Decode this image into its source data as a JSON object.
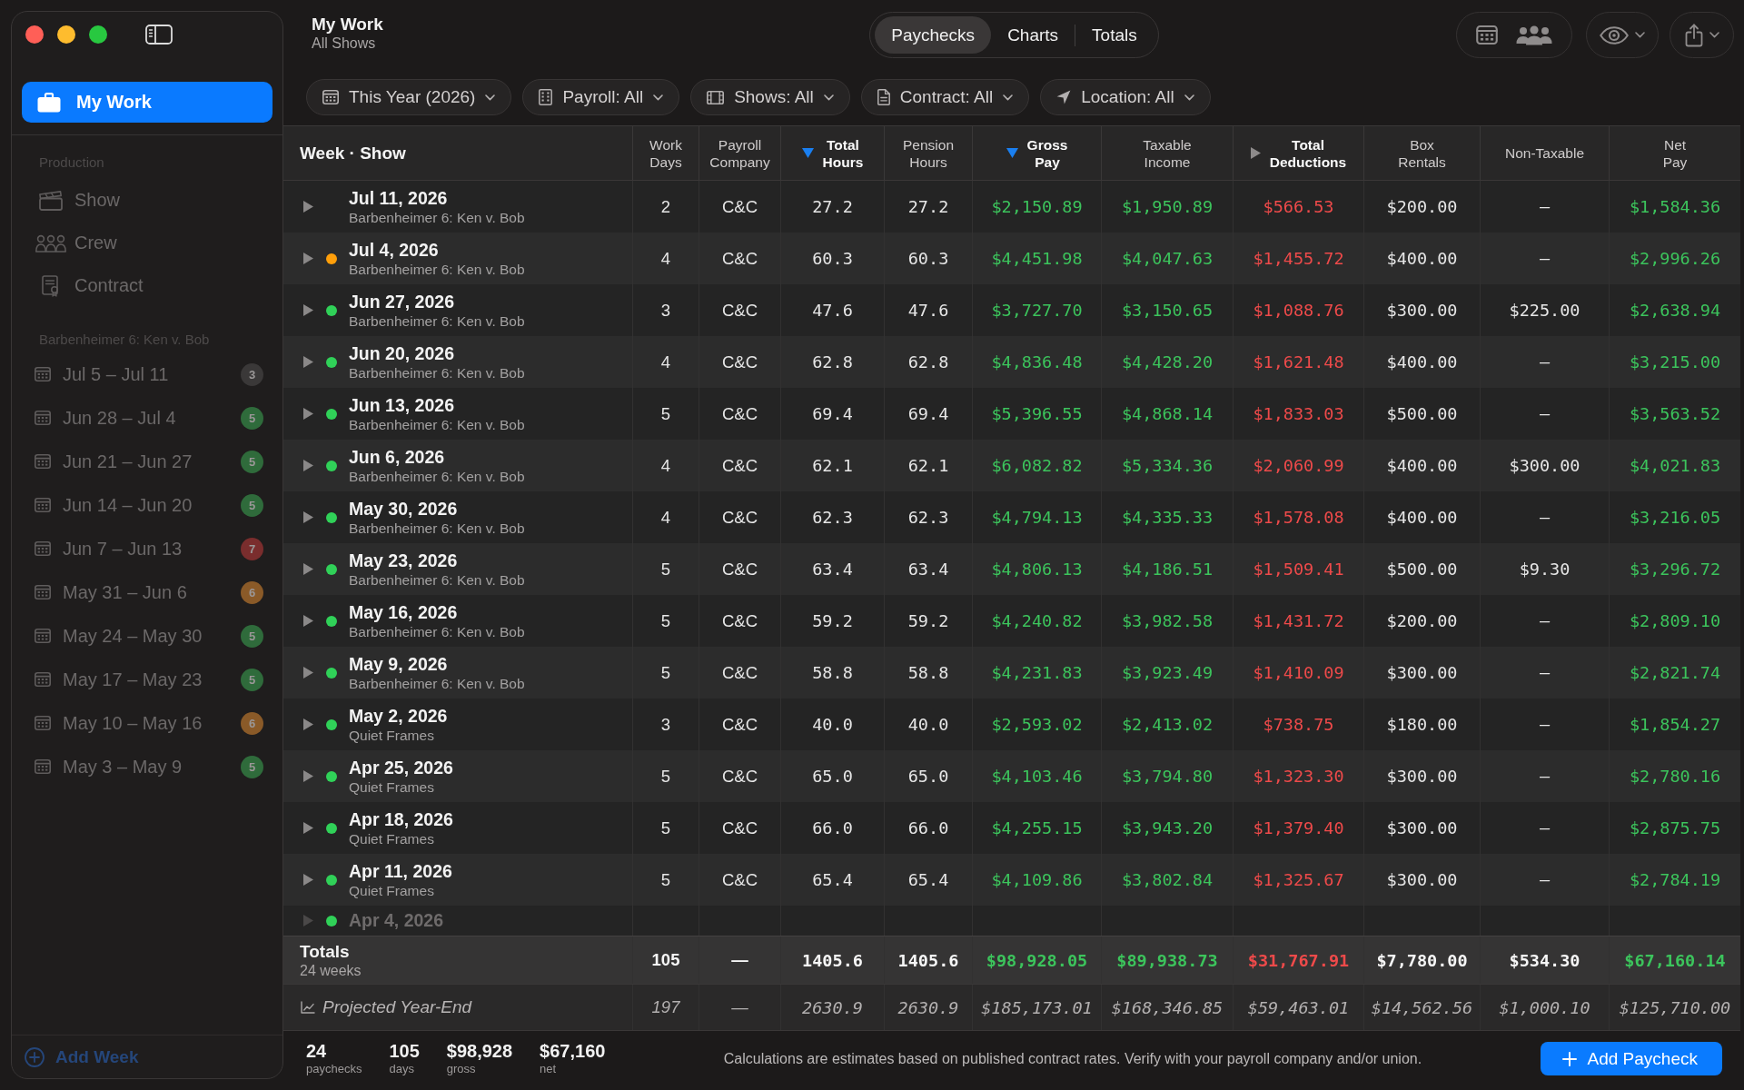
{
  "sidebar": {
    "nav": [
      {
        "label": "My Work",
        "selected": true
      }
    ],
    "sections": [
      {
        "title": "Production",
        "items": [
          {
            "kind": "show",
            "label": "Show",
            "selected": false
          },
          {
            "kind": "crew",
            "label": "Crew",
            "selected": false
          },
          {
            "kind": "contract",
            "label": "Contract",
            "selected": false
          }
        ]
      },
      {
        "title": "Barbenheimer 6: Ken v. Bob",
        "items": [
          {
            "kind": "week",
            "label": "Jul 5 – Jul 11",
            "count": "3",
            "color": "#3a3838",
            "selected": false
          },
          {
            "kind": "week",
            "label": "Jun 28 – Jul 4",
            "count": "5",
            "color": "#2f6b3b",
            "selected": false
          },
          {
            "kind": "week",
            "label": "Jun 21 – Jun 27",
            "count": "5",
            "color": "#2f6b3b",
            "selected": false
          },
          {
            "kind": "week",
            "label": "Jun 14 – Jun 20",
            "count": "5",
            "color": "#2f6b3b",
            "selected": false
          },
          {
            "kind": "week",
            "label": "Jun 7 – Jun 13",
            "count": "7",
            "color": "#7a2d2d",
            "selected": false
          },
          {
            "kind": "week",
            "label": "May 31 – Jun 6",
            "count": "6",
            "color": "#8a5a28",
            "selected": false
          },
          {
            "kind": "week",
            "label": "May 24 – May 30",
            "count": "5",
            "color": "#2f6b3b",
            "selected": false
          },
          {
            "kind": "week",
            "label": "May 17 – May 23",
            "count": "5",
            "color": "#2f6b3b",
            "selected": false
          },
          {
            "kind": "week",
            "label": "May 10 – May 16",
            "count": "6",
            "color": "#8a5a28",
            "selected": false
          },
          {
            "kind": "week",
            "label": "May 3 – May 9",
            "count": "5",
            "color": "#2f6b3b",
            "selected": false
          }
        ]
      }
    ],
    "add_button": "Add Week"
  },
  "header": {
    "title": "My Work",
    "subtitle": "All Shows"
  },
  "view_tabs": [
    {
      "label": "Paychecks",
      "selected": true
    },
    {
      "label": "Charts",
      "selected": false
    },
    {
      "label": "Totals",
      "selected": false
    }
  ],
  "filters": [
    {
      "kind": "period",
      "label": "This Year (2026)"
    },
    {
      "kind": "payroll",
      "label": "Payroll: All"
    },
    {
      "kind": "shows",
      "label": "Shows: All"
    },
    {
      "kind": "contract",
      "label": "Contract: All"
    },
    {
      "kind": "location",
      "label": "Location: All"
    }
  ],
  "table": {
    "columns": [
      {
        "label": "Week · Show",
        "kind": "week",
        "sorted": false
      },
      {
        "label": "Work\nDays",
        "kind": "count",
        "sorted": false
      },
      {
        "label": "Payroll\nCompany",
        "kind": "text",
        "sorted": false
      },
      {
        "label": "Total\nHours",
        "kind": "number",
        "sorted": true
      },
      {
        "label": "Pension\nHours",
        "kind": "number",
        "sorted": false
      },
      {
        "label": "Gross\nPay",
        "kind": "gain",
        "sorted": true
      },
      {
        "label": "Taxable\nIncome",
        "kind": "gain",
        "sorted": false
      },
      {
        "label": "Total\nDeductions",
        "kind": "loss",
        "sorted": false,
        "expanded": false
      },
      {
        "label": "Box\nRentals",
        "kind": "amount",
        "sorted": false
      },
      {
        "label": "Non-Taxable",
        "kind": "amount",
        "sorted": false
      },
      {
        "label": "Net\nPay",
        "kind": "gain",
        "sorted": false
      }
    ],
    "rows": [
      {
        "date": "Jul 11, 2026",
        "show": "Barbenheimer 6: Ken v. Bob",
        "expanded": false,
        "cells": [
          "2",
          "C&C",
          "27.2",
          "27.2",
          "$2,150.89",
          "$1,950.89",
          "$566.53",
          "$200.00",
          "—",
          "$1,584.36"
        ]
      },
      {
        "date": "Jul 4, 2026",
        "show": "Barbenheimer 6: Ken v. Bob",
        "expanded": false,
        "color": "#ff9f0a",
        "cells": [
          "4",
          "C&C",
          "60.3",
          "60.3",
          "$4,451.98",
          "$4,047.63",
          "$1,455.72",
          "$400.00",
          "—",
          "$2,996.26"
        ]
      },
      {
        "date": "Jun 27, 2026",
        "show": "Barbenheimer 6: Ken v. Bob",
        "expanded": false,
        "color": "#30d158",
        "cells": [
          "3",
          "C&C",
          "47.6",
          "47.6",
          "$3,727.70",
          "$3,150.65",
          "$1,088.76",
          "$300.00",
          "$225.00",
          "$2,638.94"
        ]
      },
      {
        "date": "Jun 20, 2026",
        "show": "Barbenheimer 6: Ken v. Bob",
        "expanded": false,
        "color": "#30d158",
        "cells": [
          "4",
          "C&C",
          "62.8",
          "62.8",
          "$4,836.48",
          "$4,428.20",
          "$1,621.48",
          "$400.00",
          "—",
          "$3,215.00"
        ]
      },
      {
        "date": "Jun 13, 2026",
        "show": "Barbenheimer 6: Ken v. Bob",
        "expanded": false,
        "color": "#30d158",
        "cells": [
          "5",
          "C&C",
          "69.4",
          "69.4",
          "$5,396.55",
          "$4,868.14",
          "$1,833.03",
          "$500.00",
          "—",
          "$3,563.52"
        ]
      },
      {
        "date": "Jun 6, 2026",
        "show": "Barbenheimer 6: Ken v. Bob",
        "expanded": false,
        "color": "#30d158",
        "cells": [
          "4",
          "C&C",
          "62.1",
          "62.1",
          "$6,082.82",
          "$5,334.36",
          "$2,060.99",
          "$400.00",
          "$300.00",
          "$4,021.83"
        ]
      },
      {
        "date": "May 30, 2026",
        "show": "Barbenheimer 6: Ken v. Bob",
        "expanded": false,
        "color": "#30d158",
        "cells": [
          "4",
          "C&C",
          "62.3",
          "62.3",
          "$4,794.13",
          "$4,335.33",
          "$1,578.08",
          "$400.00",
          "—",
          "$3,216.05"
        ]
      },
      {
        "date": "May 23, 2026",
        "show": "Barbenheimer 6: Ken v. Bob",
        "expanded": false,
        "color": "#30d158",
        "cells": [
          "5",
          "C&C",
          "63.4",
          "63.4",
          "$4,806.13",
          "$4,186.51",
          "$1,509.41",
          "$500.00",
          "$9.30",
          "$3,296.72"
        ]
      },
      {
        "date": "May 16, 2026",
        "show": "Barbenheimer 6: Ken v. Bob",
        "expanded": false,
        "color": "#30d158",
        "cells": [
          "5",
          "C&C",
          "59.2",
          "59.2",
          "$4,240.82",
          "$3,982.58",
          "$1,431.72",
          "$200.00",
          "—",
          "$2,809.10"
        ]
      },
      {
        "date": "May 9, 2026",
        "show": "Barbenheimer 6: Ken v. Bob",
        "expanded": false,
        "color": "#30d158",
        "cells": [
          "5",
          "C&C",
          "58.8",
          "58.8",
          "$4,231.83",
          "$3,923.49",
          "$1,410.09",
          "$300.00",
          "—",
          "$2,821.74"
        ]
      },
      {
        "date": "May 2, 2026",
        "show": "Quiet Frames",
        "expanded": false,
        "color": "#30d158",
        "cells": [
          "3",
          "C&C",
          "40.0",
          "40.0",
          "$2,593.02",
          "$2,413.02",
          "$738.75",
          "$180.00",
          "—",
          "$1,854.27"
        ]
      },
      {
        "date": "Apr 25, 2026",
        "show": "Quiet Frames",
        "expanded": false,
        "color": "#30d158",
        "cells": [
          "5",
          "C&C",
          "65.0",
          "65.0",
          "$4,103.46",
          "$3,794.80",
          "$1,323.30",
          "$300.00",
          "—",
          "$2,780.16"
        ]
      },
      {
        "date": "Apr 18, 2026",
        "show": "Quiet Frames",
        "expanded": false,
        "color": "#30d158",
        "cells": [
          "5",
          "C&C",
          "66.0",
          "66.0",
          "$4,255.15",
          "$3,943.20",
          "$1,379.40",
          "$300.00",
          "—",
          "$2,875.75"
        ]
      },
      {
        "date": "Apr 11, 2026",
        "show": "Quiet Frames",
        "expanded": false,
        "color": "#30d158",
        "cells": [
          "5",
          "C&C",
          "65.4",
          "65.4",
          "$4,109.86",
          "$3,802.84",
          "$1,325.67",
          "$300.00",
          "—",
          "$2,784.19"
        ]
      },
      {
        "date": "Apr 4, 2026",
        "expanded": false,
        "color": "#30d158"
      }
    ],
    "totals": {
      "label": "Totals",
      "sublabel": "24 weeks",
      "cells": [
        "105",
        "—",
        "1405.6",
        "1405.6",
        "$98,928.05",
        "$89,938.73",
        "$31,767.91",
        "$7,780.00",
        "$534.30",
        "$67,160.14"
      ]
    },
    "projected": {
      "label": "Projected Year-End",
      "cells": [
        "197",
        "—",
        "2630.9",
        "2630.9",
        "$185,173.01",
        "$168,346.85",
        "$59,463.01",
        "$14,562.56",
        "$1,000.10",
        "$125,710.00"
      ]
    }
  },
  "footer": {
    "stats": [
      {
        "value": "24",
        "label": "paychecks"
      },
      {
        "value": "105",
        "label": "days"
      },
      {
        "value": "$98,928",
        "label": "gross"
      },
      {
        "value": "$67,160",
        "label": "net"
      }
    ],
    "note": "Calculations are estimates based on published contract rates. Verify with your payroll company and/or union.",
    "add_button": "Add Paycheck"
  }
}
